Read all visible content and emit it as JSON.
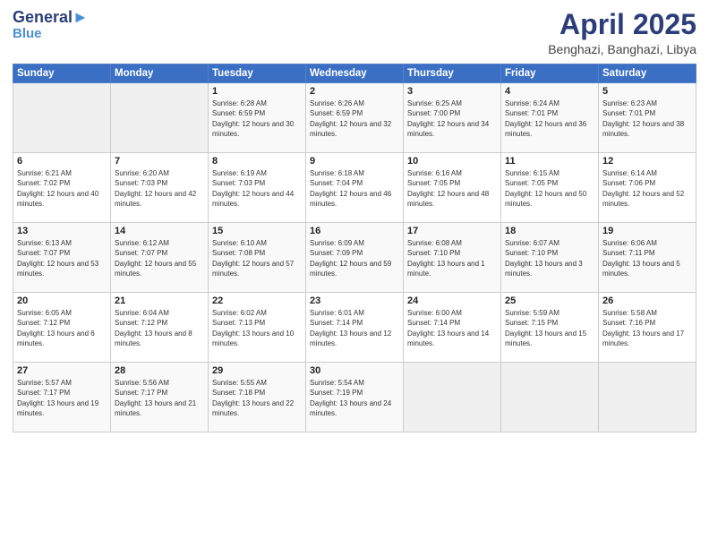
{
  "header": {
    "logo_line1": "General",
    "logo_line2": "Blue",
    "title": "April 2025",
    "location": "Benghazi, Banghazi, Libya"
  },
  "weekdays": [
    "Sunday",
    "Monday",
    "Tuesday",
    "Wednesday",
    "Thursday",
    "Friday",
    "Saturday"
  ],
  "weeks": [
    [
      {
        "day": "",
        "sunrise": "",
        "sunset": "",
        "daylight": ""
      },
      {
        "day": "",
        "sunrise": "",
        "sunset": "",
        "daylight": ""
      },
      {
        "day": "1",
        "sunrise": "Sunrise: 6:28 AM",
        "sunset": "Sunset: 6:59 PM",
        "daylight": "Daylight: 12 hours and 30 minutes."
      },
      {
        "day": "2",
        "sunrise": "Sunrise: 6:26 AM",
        "sunset": "Sunset: 6:59 PM",
        "daylight": "Daylight: 12 hours and 32 minutes."
      },
      {
        "day": "3",
        "sunrise": "Sunrise: 6:25 AM",
        "sunset": "Sunset: 7:00 PM",
        "daylight": "Daylight: 12 hours and 34 minutes."
      },
      {
        "day": "4",
        "sunrise": "Sunrise: 6:24 AM",
        "sunset": "Sunset: 7:01 PM",
        "daylight": "Daylight: 12 hours and 36 minutes."
      },
      {
        "day": "5",
        "sunrise": "Sunrise: 6:23 AM",
        "sunset": "Sunset: 7:01 PM",
        "daylight": "Daylight: 12 hours and 38 minutes."
      }
    ],
    [
      {
        "day": "6",
        "sunrise": "Sunrise: 6:21 AM",
        "sunset": "Sunset: 7:02 PM",
        "daylight": "Daylight: 12 hours and 40 minutes."
      },
      {
        "day": "7",
        "sunrise": "Sunrise: 6:20 AM",
        "sunset": "Sunset: 7:03 PM",
        "daylight": "Daylight: 12 hours and 42 minutes."
      },
      {
        "day": "8",
        "sunrise": "Sunrise: 6:19 AM",
        "sunset": "Sunset: 7:03 PM",
        "daylight": "Daylight: 12 hours and 44 minutes."
      },
      {
        "day": "9",
        "sunrise": "Sunrise: 6:18 AM",
        "sunset": "Sunset: 7:04 PM",
        "daylight": "Daylight: 12 hours and 46 minutes."
      },
      {
        "day": "10",
        "sunrise": "Sunrise: 6:16 AM",
        "sunset": "Sunset: 7:05 PM",
        "daylight": "Daylight: 12 hours and 48 minutes."
      },
      {
        "day": "11",
        "sunrise": "Sunrise: 6:15 AM",
        "sunset": "Sunset: 7:05 PM",
        "daylight": "Daylight: 12 hours and 50 minutes."
      },
      {
        "day": "12",
        "sunrise": "Sunrise: 6:14 AM",
        "sunset": "Sunset: 7:06 PM",
        "daylight": "Daylight: 12 hours and 52 minutes."
      }
    ],
    [
      {
        "day": "13",
        "sunrise": "Sunrise: 6:13 AM",
        "sunset": "Sunset: 7:07 PM",
        "daylight": "Daylight: 12 hours and 53 minutes."
      },
      {
        "day": "14",
        "sunrise": "Sunrise: 6:12 AM",
        "sunset": "Sunset: 7:07 PM",
        "daylight": "Daylight: 12 hours and 55 minutes."
      },
      {
        "day": "15",
        "sunrise": "Sunrise: 6:10 AM",
        "sunset": "Sunset: 7:08 PM",
        "daylight": "Daylight: 12 hours and 57 minutes."
      },
      {
        "day": "16",
        "sunrise": "Sunrise: 6:09 AM",
        "sunset": "Sunset: 7:09 PM",
        "daylight": "Daylight: 12 hours and 59 minutes."
      },
      {
        "day": "17",
        "sunrise": "Sunrise: 6:08 AM",
        "sunset": "Sunset: 7:10 PM",
        "daylight": "Daylight: 13 hours and 1 minute."
      },
      {
        "day": "18",
        "sunrise": "Sunrise: 6:07 AM",
        "sunset": "Sunset: 7:10 PM",
        "daylight": "Daylight: 13 hours and 3 minutes."
      },
      {
        "day": "19",
        "sunrise": "Sunrise: 6:06 AM",
        "sunset": "Sunset: 7:11 PM",
        "daylight": "Daylight: 13 hours and 5 minutes."
      }
    ],
    [
      {
        "day": "20",
        "sunrise": "Sunrise: 6:05 AM",
        "sunset": "Sunset: 7:12 PM",
        "daylight": "Daylight: 13 hours and 6 minutes."
      },
      {
        "day": "21",
        "sunrise": "Sunrise: 6:04 AM",
        "sunset": "Sunset: 7:12 PM",
        "daylight": "Daylight: 13 hours and 8 minutes."
      },
      {
        "day": "22",
        "sunrise": "Sunrise: 6:02 AM",
        "sunset": "Sunset: 7:13 PM",
        "daylight": "Daylight: 13 hours and 10 minutes."
      },
      {
        "day": "23",
        "sunrise": "Sunrise: 6:01 AM",
        "sunset": "Sunset: 7:14 PM",
        "daylight": "Daylight: 13 hours and 12 minutes."
      },
      {
        "day": "24",
        "sunrise": "Sunrise: 6:00 AM",
        "sunset": "Sunset: 7:14 PM",
        "daylight": "Daylight: 13 hours and 14 minutes."
      },
      {
        "day": "25",
        "sunrise": "Sunrise: 5:59 AM",
        "sunset": "Sunset: 7:15 PM",
        "daylight": "Daylight: 13 hours and 15 minutes."
      },
      {
        "day": "26",
        "sunrise": "Sunrise: 5:58 AM",
        "sunset": "Sunset: 7:16 PM",
        "daylight": "Daylight: 13 hours and 17 minutes."
      }
    ],
    [
      {
        "day": "27",
        "sunrise": "Sunrise: 5:57 AM",
        "sunset": "Sunset: 7:17 PM",
        "daylight": "Daylight: 13 hours and 19 minutes."
      },
      {
        "day": "28",
        "sunrise": "Sunrise: 5:56 AM",
        "sunset": "Sunset: 7:17 PM",
        "daylight": "Daylight: 13 hours and 21 minutes."
      },
      {
        "day": "29",
        "sunrise": "Sunrise: 5:55 AM",
        "sunset": "Sunset: 7:18 PM",
        "daylight": "Daylight: 13 hours and 22 minutes."
      },
      {
        "day": "30",
        "sunrise": "Sunrise: 5:54 AM",
        "sunset": "Sunset: 7:19 PM",
        "daylight": "Daylight: 13 hours and 24 minutes."
      },
      {
        "day": "",
        "sunrise": "",
        "sunset": "",
        "daylight": ""
      },
      {
        "day": "",
        "sunrise": "",
        "sunset": "",
        "daylight": ""
      },
      {
        "day": "",
        "sunrise": "",
        "sunset": "",
        "daylight": ""
      }
    ]
  ]
}
